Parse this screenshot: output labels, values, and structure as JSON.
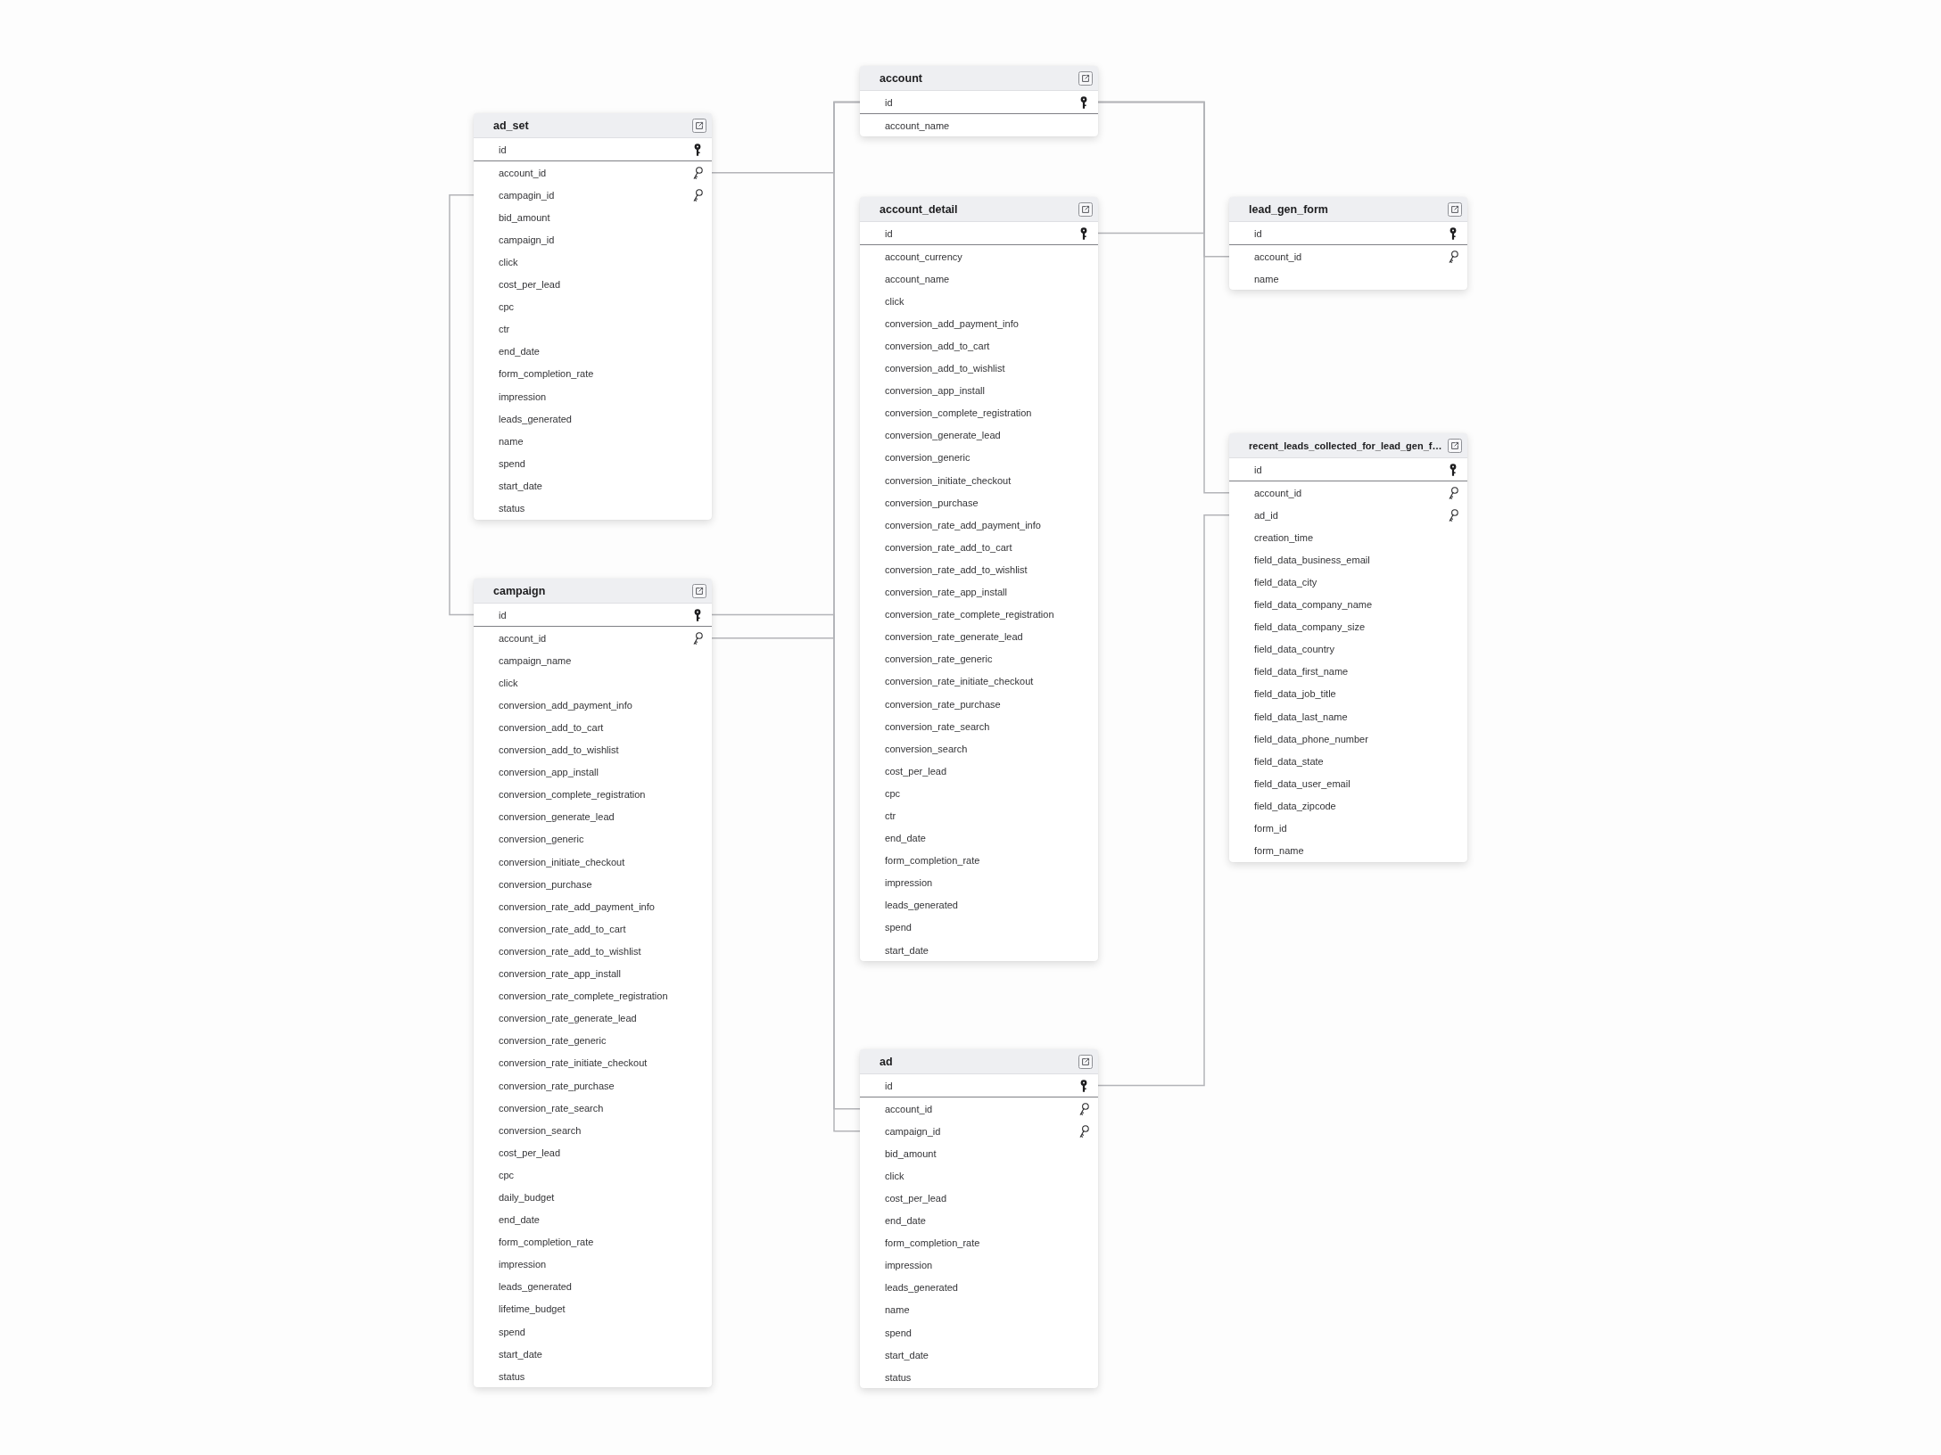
{
  "tables": [
    {
      "name": "account",
      "columns": [
        {
          "name": "id",
          "kind": "primary"
        },
        {
          "name": "account_name",
          "kind": "plain"
        }
      ]
    },
    {
      "name": "ad_set",
      "columns": [
        {
          "name": "id",
          "kind": "primary"
        },
        {
          "name": "account_id",
          "kind": "foreign"
        },
        {
          "name": "campagin_id",
          "kind": "foreign"
        },
        {
          "name": "bid_amount",
          "kind": "plain"
        },
        {
          "name": "campaign_id",
          "kind": "plain"
        },
        {
          "name": "click",
          "kind": "plain"
        },
        {
          "name": "cost_per_lead",
          "kind": "plain"
        },
        {
          "name": "cpc",
          "kind": "plain"
        },
        {
          "name": "ctr",
          "kind": "plain"
        },
        {
          "name": "end_date",
          "kind": "plain"
        },
        {
          "name": "form_completion_rate",
          "kind": "plain"
        },
        {
          "name": "impression",
          "kind": "plain"
        },
        {
          "name": "leads_generated",
          "kind": "plain"
        },
        {
          "name": "name",
          "kind": "plain"
        },
        {
          "name": "spend",
          "kind": "plain"
        },
        {
          "name": "start_date",
          "kind": "plain"
        },
        {
          "name": "status",
          "kind": "plain"
        }
      ]
    },
    {
      "name": "account_detail",
      "columns": [
        {
          "name": "id",
          "kind": "primary"
        },
        {
          "name": "account_currency",
          "kind": "plain"
        },
        {
          "name": "account_name",
          "kind": "plain"
        },
        {
          "name": "click",
          "kind": "plain"
        },
        {
          "name": "conversion_add_payment_info",
          "kind": "plain"
        },
        {
          "name": "conversion_add_to_cart",
          "kind": "plain"
        },
        {
          "name": "conversion_add_to_wishlist",
          "kind": "plain"
        },
        {
          "name": "conversion_app_install",
          "kind": "plain"
        },
        {
          "name": "conversion_complete_registration",
          "kind": "plain"
        },
        {
          "name": "conversion_generate_lead",
          "kind": "plain"
        },
        {
          "name": "conversion_generic",
          "kind": "plain"
        },
        {
          "name": "conversion_initiate_checkout",
          "kind": "plain"
        },
        {
          "name": "conversion_purchase",
          "kind": "plain"
        },
        {
          "name": "conversion_rate_add_payment_info",
          "kind": "plain"
        },
        {
          "name": "conversion_rate_add_to_cart",
          "kind": "plain"
        },
        {
          "name": "conversion_rate_add_to_wishlist",
          "kind": "plain"
        },
        {
          "name": "conversion_rate_app_install",
          "kind": "plain"
        },
        {
          "name": "conversion_rate_complete_registration",
          "kind": "plain"
        },
        {
          "name": "conversion_rate_generate_lead",
          "kind": "plain"
        },
        {
          "name": "conversion_rate_generic",
          "kind": "plain"
        },
        {
          "name": "conversion_rate_initiate_checkout",
          "kind": "plain"
        },
        {
          "name": "conversion_rate_purchase",
          "kind": "plain"
        },
        {
          "name": "conversion_rate_search",
          "kind": "plain"
        },
        {
          "name": "conversion_search",
          "kind": "plain"
        },
        {
          "name": "cost_per_lead",
          "kind": "plain"
        },
        {
          "name": "cpc",
          "kind": "plain"
        },
        {
          "name": "ctr",
          "kind": "plain"
        },
        {
          "name": "end_date",
          "kind": "plain"
        },
        {
          "name": "form_completion_rate",
          "kind": "plain"
        },
        {
          "name": "impression",
          "kind": "plain"
        },
        {
          "name": "leads_generated",
          "kind": "plain"
        },
        {
          "name": "spend",
          "kind": "plain"
        },
        {
          "name": "start_date",
          "kind": "plain"
        }
      ]
    },
    {
      "name": "lead_gen_form",
      "columns": [
        {
          "name": "id",
          "kind": "primary"
        },
        {
          "name": "account_id",
          "kind": "foreign"
        },
        {
          "name": "name",
          "kind": "plain"
        }
      ]
    },
    {
      "name": "recent_leads_collected_for_lead_gen_f…",
      "columns": [
        {
          "name": "id",
          "kind": "primary"
        },
        {
          "name": "account_id",
          "kind": "foreign"
        },
        {
          "name": "ad_id",
          "kind": "foreign"
        },
        {
          "name": "creation_time",
          "kind": "plain"
        },
        {
          "name": "field_data_business_email",
          "kind": "plain"
        },
        {
          "name": "field_data_city",
          "kind": "plain"
        },
        {
          "name": "field_data_company_name",
          "kind": "plain"
        },
        {
          "name": "field_data_company_size",
          "kind": "plain"
        },
        {
          "name": "field_data_country",
          "kind": "plain"
        },
        {
          "name": "field_data_first_name",
          "kind": "plain"
        },
        {
          "name": "field_data_job_title",
          "kind": "plain"
        },
        {
          "name": "field_data_last_name",
          "kind": "plain"
        },
        {
          "name": "field_data_phone_number",
          "kind": "plain"
        },
        {
          "name": "field_data_state",
          "kind": "plain"
        },
        {
          "name": "field_data_user_email",
          "kind": "plain"
        },
        {
          "name": "field_data_zipcode",
          "kind": "plain"
        },
        {
          "name": "form_id",
          "kind": "plain"
        },
        {
          "name": "form_name",
          "kind": "plain"
        }
      ]
    },
    {
      "name": "campaign",
      "columns": [
        {
          "name": "id",
          "kind": "primary"
        },
        {
          "name": "account_id",
          "kind": "foreign"
        },
        {
          "name": "campaign_name",
          "kind": "plain"
        },
        {
          "name": "click",
          "kind": "plain"
        },
        {
          "name": "conversion_add_payment_info",
          "kind": "plain"
        },
        {
          "name": "conversion_add_to_cart",
          "kind": "plain"
        },
        {
          "name": "conversion_add_to_wishlist",
          "kind": "plain"
        },
        {
          "name": "conversion_app_install",
          "kind": "plain"
        },
        {
          "name": "conversion_complete_registration",
          "kind": "plain"
        },
        {
          "name": "conversion_generate_lead",
          "kind": "plain"
        },
        {
          "name": "conversion_generic",
          "kind": "plain"
        },
        {
          "name": "conversion_initiate_checkout",
          "kind": "plain"
        },
        {
          "name": "conversion_purchase",
          "kind": "plain"
        },
        {
          "name": "conversion_rate_add_payment_info",
          "kind": "plain"
        },
        {
          "name": "conversion_rate_add_to_cart",
          "kind": "plain"
        },
        {
          "name": "conversion_rate_add_to_wishlist",
          "kind": "plain"
        },
        {
          "name": "conversion_rate_app_install",
          "kind": "plain"
        },
        {
          "name": "conversion_rate_complete_registration",
          "kind": "plain"
        },
        {
          "name": "conversion_rate_generate_lead",
          "kind": "plain"
        },
        {
          "name": "conversion_rate_generic",
          "kind": "plain"
        },
        {
          "name": "conversion_rate_initiate_checkout",
          "kind": "plain"
        },
        {
          "name": "conversion_rate_purchase",
          "kind": "plain"
        },
        {
          "name": "conversion_rate_search",
          "kind": "plain"
        },
        {
          "name": "conversion_search",
          "kind": "plain"
        },
        {
          "name": "cost_per_lead",
          "kind": "plain"
        },
        {
          "name": "cpc",
          "kind": "plain"
        },
        {
          "name": "daily_budget",
          "kind": "plain"
        },
        {
          "name": "end_date",
          "kind": "plain"
        },
        {
          "name": "form_completion_rate",
          "kind": "plain"
        },
        {
          "name": "impression",
          "kind": "plain"
        },
        {
          "name": "leads_generated",
          "kind": "plain"
        },
        {
          "name": "lifetime_budget",
          "kind": "plain"
        },
        {
          "name": "spend",
          "kind": "plain"
        },
        {
          "name": "start_date",
          "kind": "plain"
        },
        {
          "name": "status",
          "kind": "plain"
        }
      ]
    },
    {
      "name": "ad",
      "columns": [
        {
          "name": "id",
          "kind": "primary"
        },
        {
          "name": "account_id",
          "kind": "foreign"
        },
        {
          "name": "campaign_id",
          "kind": "foreign"
        },
        {
          "name": "bid_amount",
          "kind": "plain"
        },
        {
          "name": "click",
          "kind": "plain"
        },
        {
          "name": "cost_per_lead",
          "kind": "plain"
        },
        {
          "name": "end_date",
          "kind": "plain"
        },
        {
          "name": "form_completion_rate",
          "kind": "plain"
        },
        {
          "name": "impression",
          "kind": "plain"
        },
        {
          "name": "leads_generated",
          "kind": "plain"
        },
        {
          "name": "name",
          "kind": "plain"
        },
        {
          "name": "spend",
          "kind": "plain"
        },
        {
          "name": "start_date",
          "kind": "plain"
        },
        {
          "name": "status",
          "kind": "plain"
        }
      ]
    }
  ]
}
